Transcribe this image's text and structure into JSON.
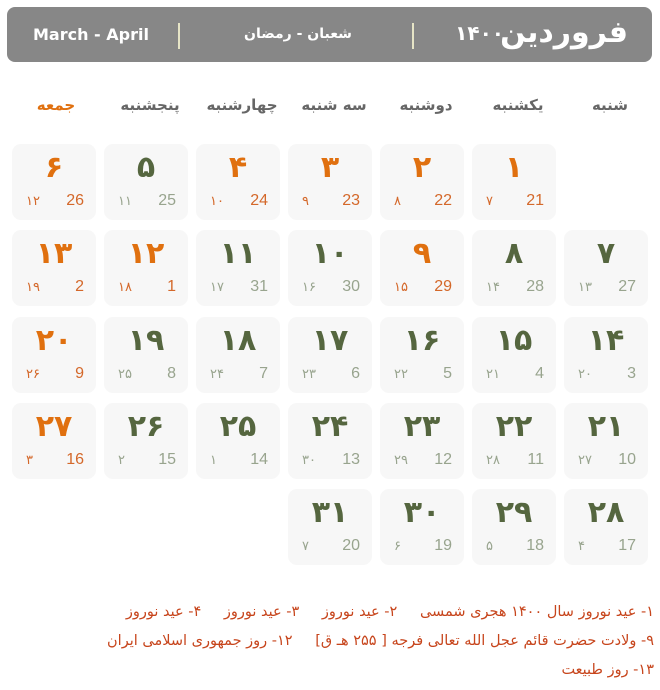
{
  "header": {
    "persian_month": "فروردین",
    "year": "۱۴۰۰",
    "hijri_months": "شعبان - رمضان",
    "gregorian_months": "March - April"
  },
  "weekdays": [
    "شنبه",
    "یکشنبه",
    "دوشنبه",
    "سه شنبه",
    "چهارشنبه",
    "پنجشنبه",
    "جمعه"
  ],
  "colors": {
    "header_bg": "#878787",
    "holiday": "#e0700f",
    "normal_day": "#55663f",
    "secondary_date": "#98a48e",
    "notes": "#c7451c"
  },
  "weeks": [
    [
      null,
      {
        "day": "۱",
        "hijri": "۷",
        "greg": "21",
        "holiday": true
      },
      {
        "day": "۲",
        "hijri": "۸",
        "greg": "22",
        "holiday": true
      },
      {
        "day": "۳",
        "hijri": "۹",
        "greg": "23",
        "holiday": true
      },
      {
        "day": "۴",
        "hijri": "۱۰",
        "greg": "24",
        "holiday": true
      },
      {
        "day": "۵",
        "hijri": "۱۱",
        "greg": "25",
        "holiday": false
      },
      {
        "day": "۶",
        "hijri": "۱۲",
        "greg": "26",
        "holiday": true
      }
    ],
    [
      {
        "day": "۷",
        "hijri": "۱۳",
        "greg": "27",
        "holiday": false
      },
      {
        "day": "۸",
        "hijri": "۱۴",
        "greg": "28",
        "holiday": false
      },
      {
        "day": "۹",
        "hijri": "۱۵",
        "greg": "29",
        "holiday": true
      },
      {
        "day": "۱۰",
        "hijri": "۱۶",
        "greg": "30",
        "holiday": false
      },
      {
        "day": "۱۱",
        "hijri": "۱۷",
        "greg": "31",
        "holiday": false
      },
      {
        "day": "۱۲",
        "hijri": "۱۸",
        "greg": "1",
        "holiday": true
      },
      {
        "day": "۱۳",
        "hijri": "۱۹",
        "greg": "2",
        "holiday": true
      }
    ],
    [
      {
        "day": "۱۴",
        "hijri": "۲۰",
        "greg": "3",
        "holiday": false
      },
      {
        "day": "۱۵",
        "hijri": "۲۱",
        "greg": "4",
        "holiday": false
      },
      {
        "day": "۱۶",
        "hijri": "۲۲",
        "greg": "5",
        "holiday": false
      },
      {
        "day": "۱۷",
        "hijri": "۲۳",
        "greg": "6",
        "holiday": false
      },
      {
        "day": "۱۸",
        "hijri": "۲۴",
        "greg": "7",
        "holiday": false
      },
      {
        "day": "۱۹",
        "hijri": "۲۵",
        "greg": "8",
        "holiday": false
      },
      {
        "day": "۲۰",
        "hijri": "۲۶",
        "greg": "9",
        "holiday": true
      }
    ],
    [
      {
        "day": "۲۱",
        "hijri": "۲۷",
        "greg": "10",
        "holiday": false
      },
      {
        "day": "۲۲",
        "hijri": "۲۸",
        "greg": "11",
        "holiday": false
      },
      {
        "day": "۲۳",
        "hijri": "۲۹",
        "greg": "12",
        "holiday": false
      },
      {
        "day": "۲۴",
        "hijri": "۳۰",
        "greg": "13",
        "holiday": false
      },
      {
        "day": "۲۵",
        "hijri": "۱",
        "greg": "14",
        "holiday": false
      },
      {
        "day": "۲۶",
        "hijri": "۲",
        "greg": "15",
        "holiday": false
      },
      {
        "day": "۲۷",
        "hijri": "۳",
        "greg": "16",
        "holiday": true
      }
    ],
    [
      {
        "day": "۲۸",
        "hijri": "۴",
        "greg": "17",
        "holiday": false
      },
      {
        "day": "۲۹",
        "hijri": "۵",
        "greg": "18",
        "holiday": false
      },
      {
        "day": "۳۰",
        "hijri": "۶",
        "greg": "19",
        "holiday": false
      },
      {
        "day": "۳۱",
        "hijri": "۷",
        "greg": "20",
        "holiday": false
      },
      null,
      null,
      null
    ]
  ],
  "notes": [
    "۱- عید نوروز سال ۱۴۰۰ هجری شمسی",
    "۲- عید نوروز",
    "۳- عید نوروز",
    "۴- عید نوروز",
    "۹- ولادت حضرت قائم عجل الله تعالی فرجه [ ۲۵۵ هـ ق]",
    "۱۲- روز جمهوری اسلامی ایران",
    "۱۳- روز طبیعت"
  ]
}
